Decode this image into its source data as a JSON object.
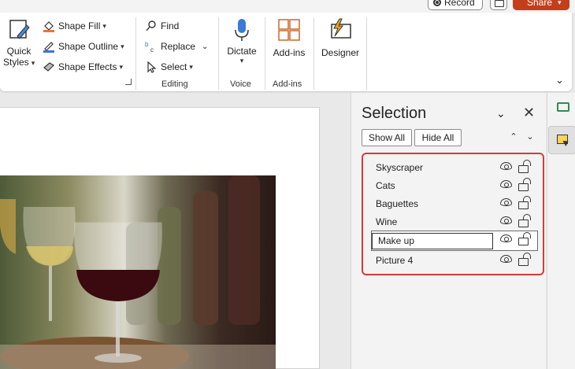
{
  "top": {
    "record_label": "Record",
    "share_label": "Share"
  },
  "ribbon": {
    "quick_styles": {
      "line1": "Quick",
      "line2": "Styles"
    },
    "shape_fill": "Shape Fill",
    "shape_outline": "Shape Outline",
    "shape_effects": "Shape Effects",
    "editing": {
      "find": "Find",
      "replace": "Replace",
      "select": "Select",
      "group_label": "Editing"
    },
    "voice": {
      "dictate": "Dictate",
      "group_label": "Voice"
    },
    "addins": {
      "label": "Add-ins",
      "group_label": "Add-ins"
    },
    "designer": {
      "label": "Designer"
    },
    "colors": {
      "fill_accent": "#e8743b",
      "outline_accent": "#3b74d6",
      "mic_accent": "#3b7bd6",
      "addins_accent": "#c8692c",
      "designer_accent": "#f2a51f"
    }
  },
  "pane": {
    "title": "Selection",
    "show_all": "Show All",
    "hide_all": "Hide All",
    "highlight_color": "#d63a3a",
    "layers": [
      {
        "name": "Skyscraper",
        "editing": false
      },
      {
        "name": "Cats",
        "editing": false
      },
      {
        "name": "Baguettes",
        "editing": false
      },
      {
        "name": "Wine",
        "editing": false
      },
      {
        "name": "Make up",
        "editing": true
      },
      {
        "name": "Picture 4",
        "editing": false
      }
    ]
  },
  "slide": {
    "image": "wine-glasses-photo"
  }
}
